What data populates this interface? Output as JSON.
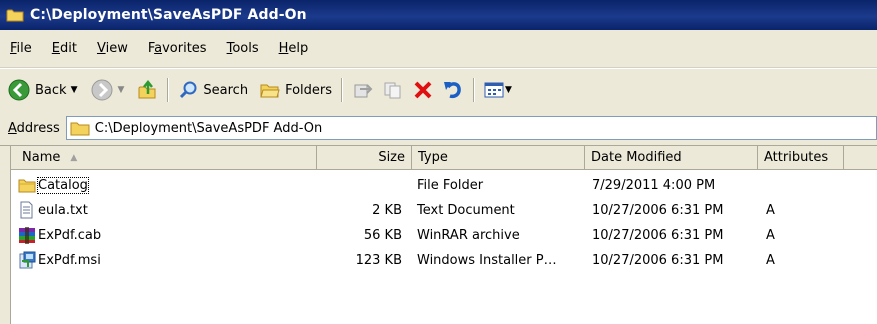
{
  "window": {
    "title": "C:\\Deployment\\SaveAsPDF Add-On"
  },
  "menu": [
    {
      "label": "File",
      "hot": "F",
      "rest": "ile"
    },
    {
      "label": "Edit",
      "hot": "E",
      "rest": "dit"
    },
    {
      "label": "View",
      "hot": "V",
      "rest": "iew"
    },
    {
      "label": "Favorites",
      "pre": "F",
      "hot": "a",
      "rest": "vorites"
    },
    {
      "label": "Tools",
      "hot": "T",
      "rest": "ools"
    },
    {
      "label": "Help",
      "hot": "H",
      "rest": "elp"
    }
  ],
  "toolbar": {
    "back_label": "Back",
    "search_label": "Search",
    "folders_label": "Folders"
  },
  "address": {
    "label_hot": "A",
    "label_rest": "ddress",
    "value": "C:\\Deployment\\SaveAsPDF Add-On"
  },
  "columns": {
    "name": "Name",
    "size": "Size",
    "type": "Type",
    "date": "Date Modified",
    "attributes": "Attributes"
  },
  "files": [
    {
      "name": "Catalog",
      "size": "",
      "type": "File Folder",
      "date": "7/29/2011 4:00 PM",
      "attributes": "",
      "icon": "folder-icon"
    },
    {
      "name": "eula.txt",
      "size": "2 KB",
      "type": "Text Document",
      "date": "10/27/2006 6:31 PM",
      "attributes": "A",
      "icon": "text-file-icon"
    },
    {
      "name": "ExPdf.cab",
      "size": "56 KB",
      "type": "WinRAR archive",
      "date": "10/27/2006 6:31 PM",
      "attributes": "A",
      "icon": "winrar-archive-icon"
    },
    {
      "name": "ExPdf.msi",
      "size": "123 KB",
      "type": "Windows Installer P…",
      "date": "10/27/2006 6:31 PM",
      "attributes": "A",
      "icon": "msi-installer-icon"
    }
  ],
  "colors": {
    "titlebar": "#0a246a",
    "chrome": "#ece9d8",
    "delete_red": "#e01010",
    "folder_yellow": "#f3d35c"
  }
}
